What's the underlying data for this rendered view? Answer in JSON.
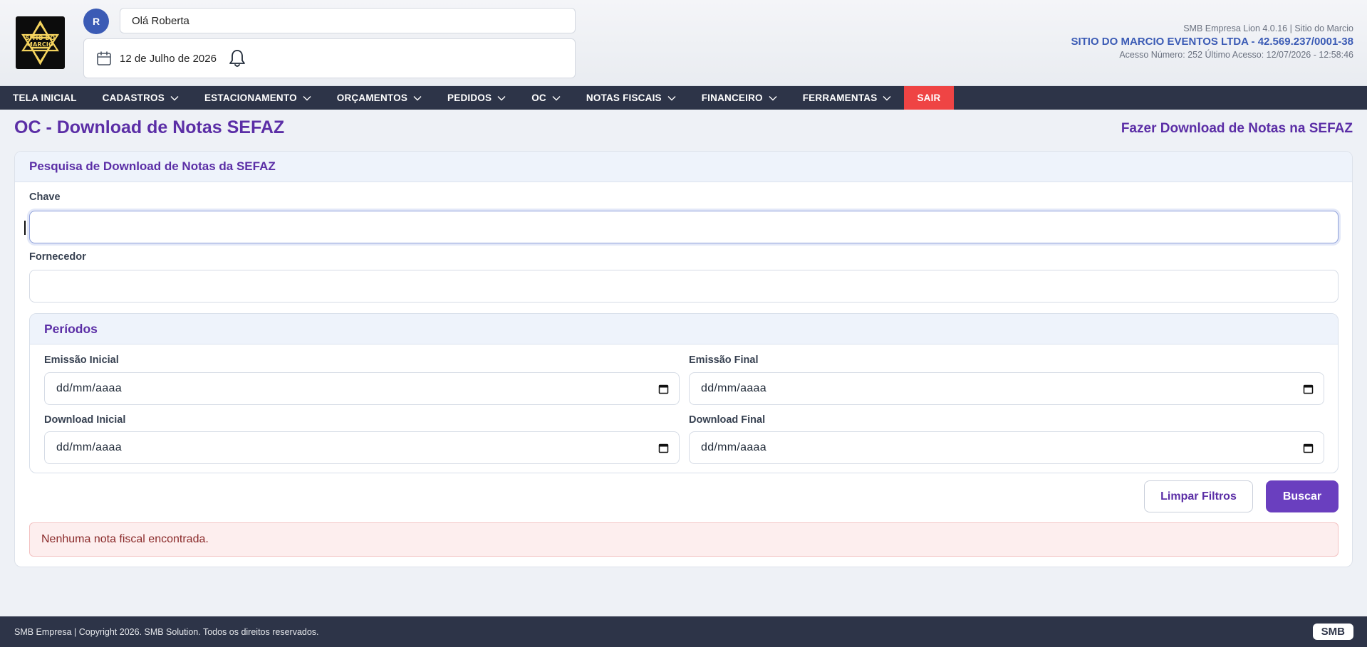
{
  "header": {
    "logo_text": "SITIO DO MARCIO",
    "avatar_initial": "R",
    "greeting": "Olá Roberta",
    "date": "12 de Julho de 2026",
    "company_line1": "SMB Empresa Lion 4.0.16 | Sitio do Marcio",
    "company_line2": "SITIO DO MARCIO EVENTOS LTDA - 42.569.237/0001-38",
    "company_line3": "Acesso Número: 252 Último Acesso: 12/07/2026 - 12:58:46"
  },
  "nav": {
    "items": [
      {
        "label": "TELA INICIAL"
      },
      {
        "label": "CADASTROS"
      },
      {
        "label": "ESTACIONAMENTO"
      },
      {
        "label": "ORÇAMENTOS"
      },
      {
        "label": "PEDIDOS"
      },
      {
        "label": "OC"
      },
      {
        "label": "NOTAS FISCAIS"
      },
      {
        "label": "FINANCEIRO"
      },
      {
        "label": "FERRAMENTAS"
      },
      {
        "label": "SAIR"
      }
    ],
    "exit_color": "#ef4444"
  },
  "page": {
    "title": "OC - Download de Notas SEFAZ",
    "subtitle": "Fazer Download de Notas na SEFAZ"
  },
  "search": {
    "card_title": "Pesquisa de Download de Notas da SEFAZ",
    "chave_label": "Chave",
    "chave_value": "",
    "fornecedor_label": "Fornecedor",
    "fornecedor_value": "",
    "periodos_title": "Períodos",
    "emissao_inicial_label": "Emissão Inicial",
    "emissao_inicial_value": "dd/mm/aaaa",
    "emissao_final_label": "Emissão Final",
    "emissao_final_value": "dd/mm/aaaa",
    "download_inicial_label": "Download Inicial",
    "download_inicial_value": "dd/mm/aaaa",
    "download_final_label": "Download Final",
    "download_final_value": "dd/mm/aaaa",
    "clear_label": "Limpar Filtros",
    "search_label": "Buscar",
    "empty_message": "Nenhuma nota fiscal encontrada."
  },
  "footer": {
    "copyright": "SMB Empresa | Copyright 2026. SMB Solution. Todos os direitos reservados.",
    "badge": "SMB"
  },
  "colors": {
    "primary": "#5b2ea6",
    "button": "#6a3fbf",
    "nav_bg": "#2d3448",
    "accent_blue": "#3b5bb5"
  }
}
